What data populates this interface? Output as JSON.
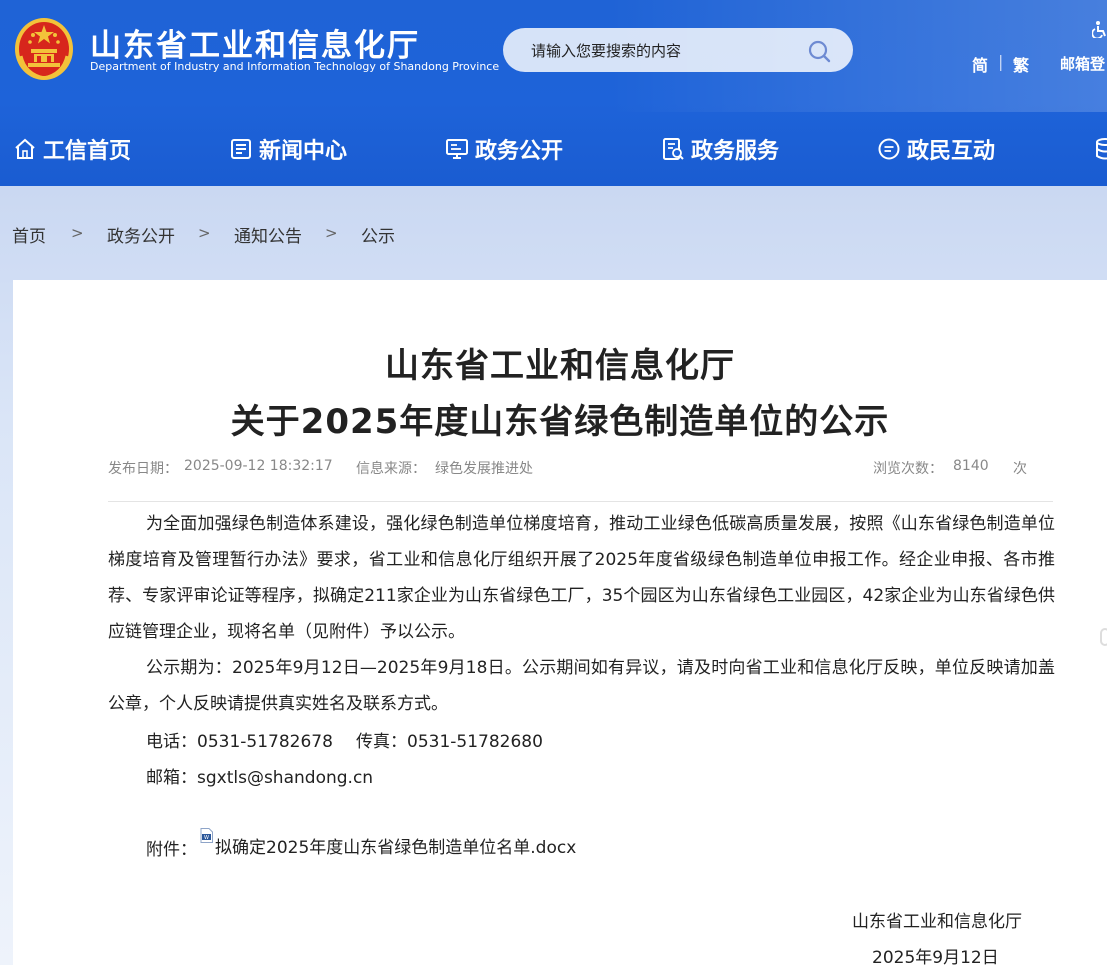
{
  "header": {
    "title": "山东省工业和信息化厅",
    "subtitle": "Department of Industry and Information Technology of Shandong Province",
    "search_placeholder": "请输入您要搜索的内容",
    "lang_simplified": "简",
    "lang_traditional": "繁",
    "lang_separator": "|",
    "mail_login": "邮箱登"
  },
  "nav": {
    "items": [
      {
        "label": "工信首页",
        "icon": "home-icon"
      },
      {
        "label": "新闻中心",
        "icon": "news-icon"
      },
      {
        "label": "政务公开",
        "icon": "monitor-icon"
      },
      {
        "label": "政务服务",
        "icon": "service-icon"
      },
      {
        "label": "政民互动",
        "icon": "chat-icon"
      }
    ]
  },
  "breadcrumb": {
    "items": [
      "首页",
      "政务公开",
      "通知公告",
      "公示"
    ],
    "separator": ">"
  },
  "article": {
    "title_line1": "山东省工业和信息化厅",
    "title_line2": "关于2025年度山东省绿色制造单位的公示",
    "publish_label": "发布日期：",
    "publish_date": "2025-09-12 18:32:17",
    "source_label": "信息来源：",
    "source": "绿色发展推进处",
    "views_label": "浏览次数：",
    "views": "8140",
    "views_unit": "次",
    "paragraph1": "为全面加强绿色制造体系建设，强化绿色制造单位梯度培育，推动工业绿色低碳高质量发展，按照《山东省绿色制造单位梯度培育及管理暂行办法》要求，省工业和信息化厅组织开展了2025年度省级绿色制造单位申报工作。经企业申报、各市推荐、专家评审论证等程序，拟确定211家企业为山东省绿色工厂，35个园区为山东省绿色工业园区，42家企业为山东省绿色供应链管理企业，现将名单（见附件）予以公示。",
    "paragraph2": "公示期为：2025年9月12日—2025年9月18日。公示期间如有异议，请及时向省工业和信息化厅反映，单位反映请加盖公章，个人反映请提供真实姓名及联系方式。",
    "phone": "电话：0531-51782678",
    "fax": "传真：0531-51782680",
    "email": "邮箱：sgxtls@shandong.cn",
    "attachment_label": "附件：",
    "attachment_name": "拟确定2025年度山东省绿色制造单位名单.docx",
    "signature_org": "山东省工业和信息化厅",
    "signature_date": "2025年9月12日"
  },
  "colors": {
    "header_blue": "#1e63d9",
    "crumb_band": "#d4dff5",
    "emblem_red": "#d7261c",
    "emblem_gold": "#f3c23a"
  }
}
